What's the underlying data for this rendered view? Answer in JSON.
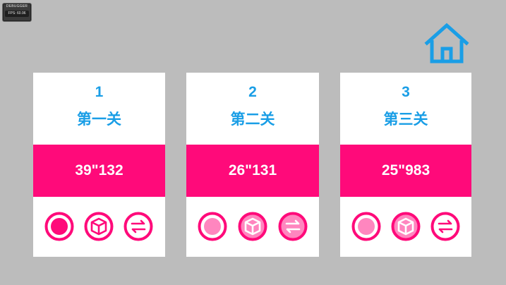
{
  "debugger": {
    "title": "DEBUGGER",
    "fps": "FPS: 60.96"
  },
  "home": {
    "icon": "home-icon"
  },
  "colors": {
    "accent_blue": "#1a9ee6",
    "accent_pink": "#ff0a7a",
    "light_pink": "#ff86bf",
    "background": "#bcbcbc"
  },
  "levels": [
    {
      "number": "1",
      "name": "第一关",
      "time": "39\"132",
      "icons": [
        {
          "name": "record-icon",
          "state": "filled"
        },
        {
          "name": "cube-icon",
          "state": "outline"
        },
        {
          "name": "swap-icon",
          "state": "outline"
        }
      ]
    },
    {
      "number": "2",
      "name": "第二关",
      "time": "26\"131",
      "icons": [
        {
          "name": "record-icon",
          "state": "light"
        },
        {
          "name": "cube-icon",
          "state": "light"
        },
        {
          "name": "swap-icon",
          "state": "light"
        }
      ]
    },
    {
      "number": "3",
      "name": "第三关",
      "time": "25\"983",
      "icons": [
        {
          "name": "record-icon",
          "state": "light"
        },
        {
          "name": "cube-icon",
          "state": "light"
        },
        {
          "name": "swap-icon",
          "state": "outline"
        }
      ]
    }
  ]
}
